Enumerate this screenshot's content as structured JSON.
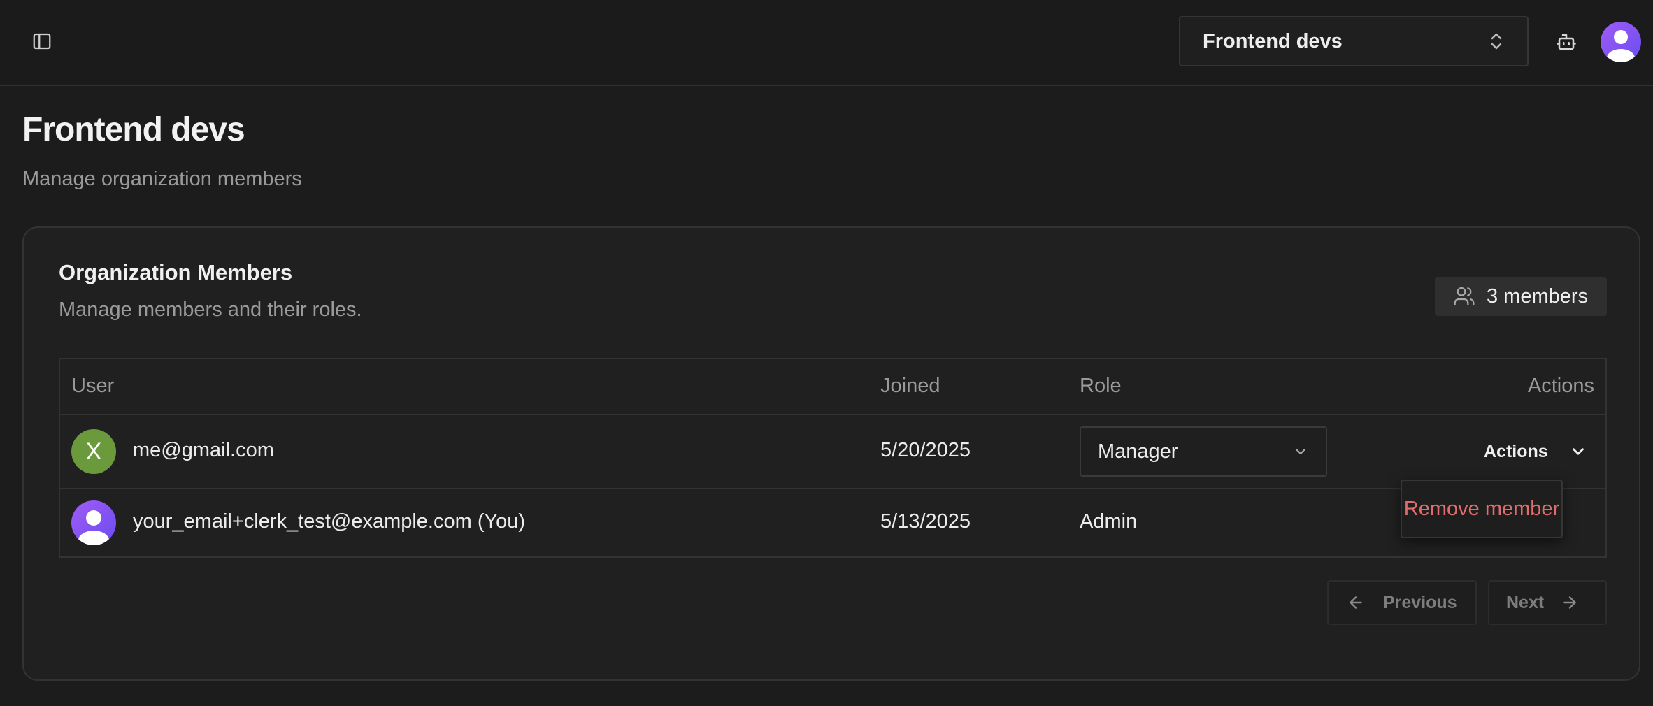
{
  "header": {
    "org_switcher_label": "Frontend devs"
  },
  "page": {
    "title": "Frontend devs",
    "subtitle": "Manage organization members"
  },
  "card": {
    "title": "Organization Members",
    "description": "Manage members and their roles.",
    "members_count": "3 members"
  },
  "table": {
    "columns": [
      "User",
      "Joined",
      "Role",
      "Actions"
    ],
    "rows": [
      {
        "avatar_letter": "X",
        "email": "me@gmail.com",
        "joined": "5/20/2025",
        "role": "Manager",
        "actions_label": "Actions"
      },
      {
        "email": "your_email+clerk_test@example.com (You)",
        "joined": "5/13/2025",
        "role": "Admin"
      }
    ]
  },
  "dropdown": {
    "remove_member": "Remove member"
  },
  "pagination": {
    "previous": "Previous",
    "next": "Next"
  },
  "colors": {
    "background": "#1c1c1c",
    "danger": "#e06c6c",
    "avatar_green": "#6b9a3c",
    "avatar_purple": "#8a55f3"
  }
}
